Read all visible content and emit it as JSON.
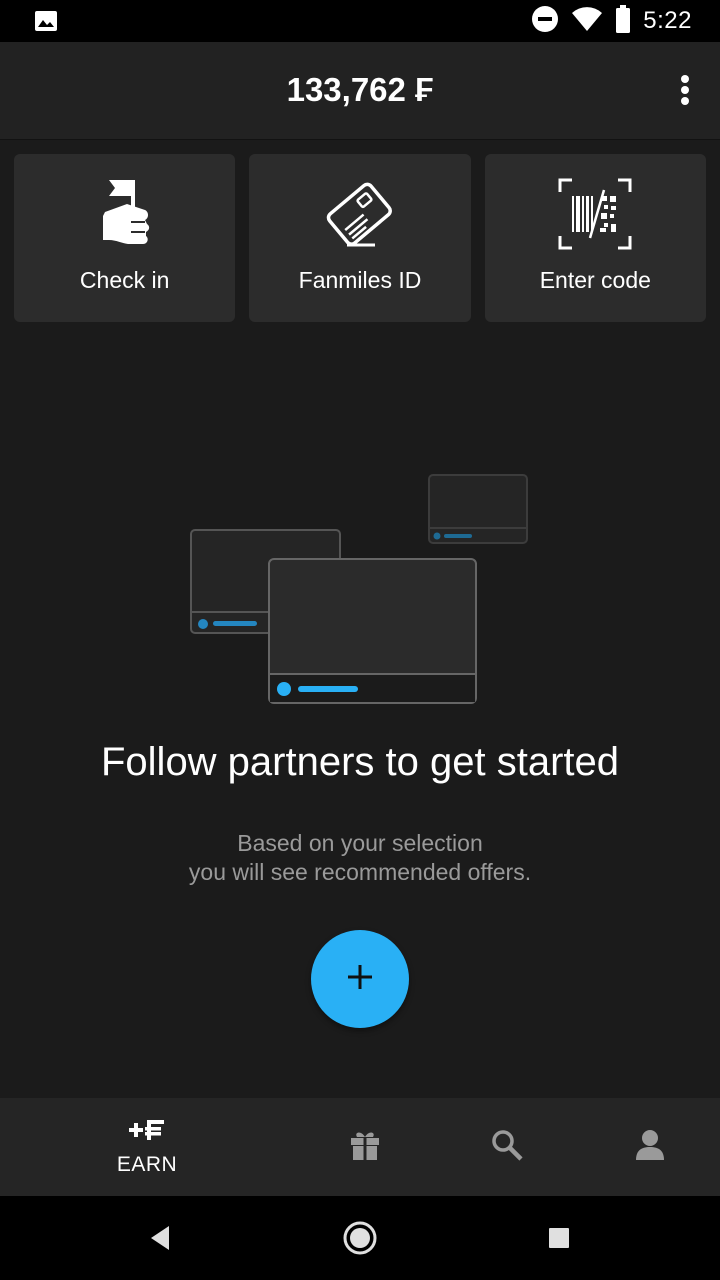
{
  "status_bar": {
    "time": "5:22",
    "icons": [
      "image-notification-icon",
      "do-not-disturb-icon",
      "wifi-icon",
      "battery-icon"
    ]
  },
  "header": {
    "balance": "133,762 ₣",
    "menu_icon": "more-vert-icon"
  },
  "quick_actions": [
    {
      "label": "Check in",
      "icon": "hand-flag-icon"
    },
    {
      "label": "Fanmiles ID",
      "icon": "card-icon"
    },
    {
      "label": "Enter code",
      "icon": "barcode-scan-icon"
    }
  ],
  "empty_state": {
    "title": "Follow partners to get started",
    "subtitle_line1": "Based on your selection",
    "subtitle_line2": "you will see recommended offers.",
    "fab_icon": "plus-icon"
  },
  "bottom_nav": {
    "earn_label": "EARN",
    "earn_glyph": "+₣",
    "items": [
      "earn",
      "rewards-gift-icon",
      "search-icon",
      "profile-icon"
    ]
  },
  "system_nav": [
    "back-icon",
    "home-icon",
    "recents-icon"
  ],
  "colors": {
    "accent": "#29b0f5",
    "background": "#1b1b1b",
    "tile": "#2c2c2c",
    "app_bar": "#222222"
  }
}
